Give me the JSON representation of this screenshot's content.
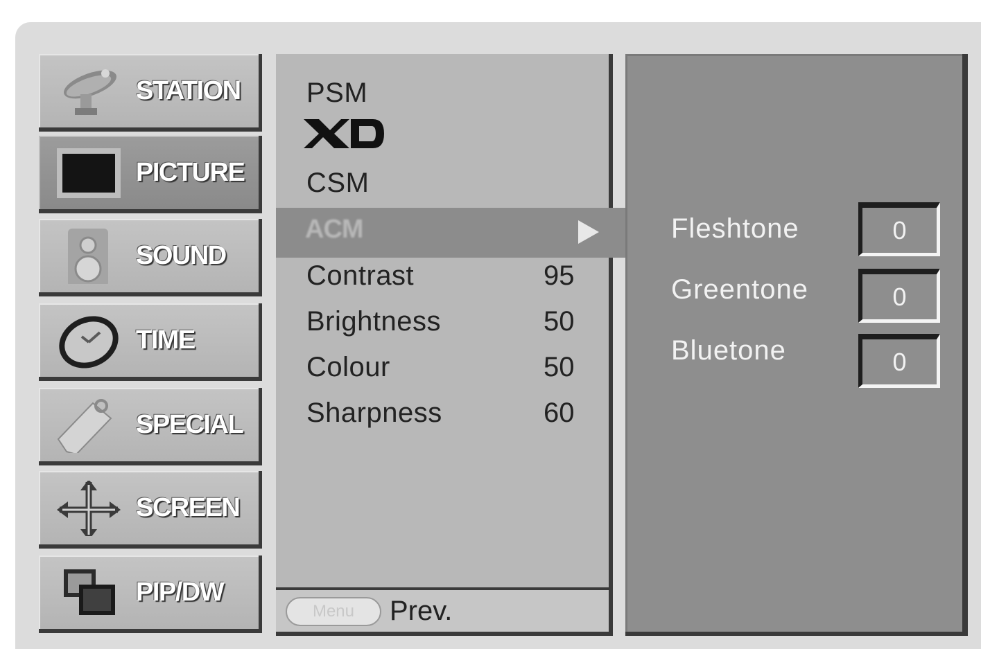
{
  "categories": [
    {
      "label": "STATION",
      "icon": "satellite-dish-icon",
      "selected": false
    },
    {
      "label": "PICTURE",
      "icon": "tv-screen-icon",
      "selected": true
    },
    {
      "label": "SOUND",
      "icon": "speaker-icon",
      "selected": false
    },
    {
      "label": "TIME",
      "icon": "clock-icon",
      "selected": false
    },
    {
      "label": "SPECIAL",
      "icon": "tag-icon",
      "selected": false
    },
    {
      "label": "SCREEN",
      "icon": "move-arrows-icon",
      "selected": false
    },
    {
      "label": "PIP/DW",
      "icon": "pip-windows-icon",
      "selected": false
    }
  ],
  "menu": {
    "psm_label": "PSM",
    "xd_logo": "XD",
    "csm_label": "CSM",
    "acm_label": "ACM",
    "items": [
      {
        "label": "Contrast",
        "value": "95"
      },
      {
        "label": "Brightness",
        "value": "50"
      },
      {
        "label": "Colour",
        "value": "50"
      },
      {
        "label": "Sharpness",
        "value": "60"
      }
    ],
    "footer_button": "Menu",
    "footer_label": "Prev."
  },
  "submenu": {
    "items": [
      {
        "label": "Fleshtone",
        "value": "0"
      },
      {
        "label": "Greentone",
        "value": "0"
      },
      {
        "label": "Bluetone",
        "value": "0"
      }
    ]
  },
  "colors": {
    "selected_category": "#8a8a8a",
    "highlight_row": "#8c8c8c",
    "submenu_panel": "#8e8e8e"
  }
}
